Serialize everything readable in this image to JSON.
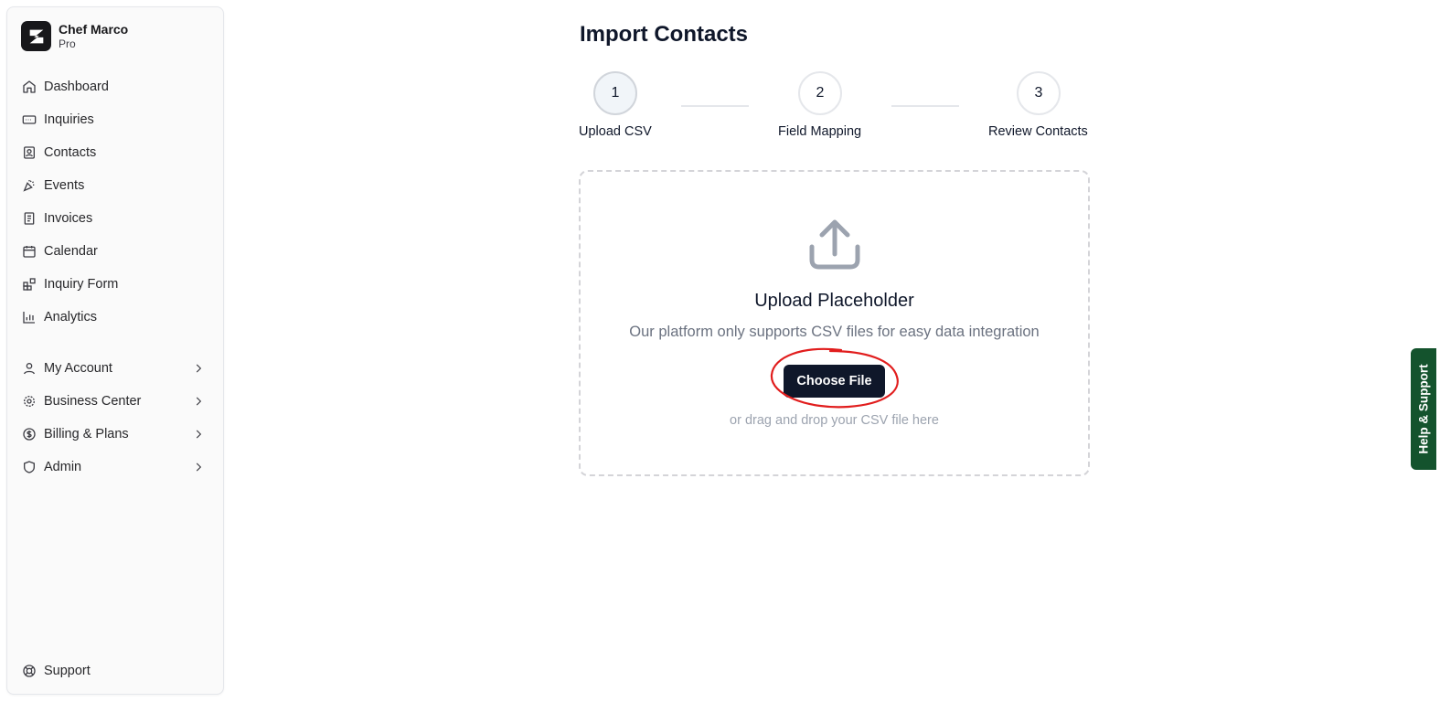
{
  "brand": {
    "name": "Chef Marco",
    "plan": "Pro"
  },
  "nav": {
    "primary": [
      {
        "label": "Dashboard",
        "icon": "home-icon"
      },
      {
        "label": "Inquiries",
        "icon": "inbox-icon"
      },
      {
        "label": "Contacts",
        "icon": "contact-card-icon"
      },
      {
        "label": "Events",
        "icon": "party-popper-icon"
      },
      {
        "label": "Invoices",
        "icon": "receipt-icon"
      },
      {
        "label": "Calendar",
        "icon": "calendar-icon"
      },
      {
        "label": "Inquiry Form",
        "icon": "form-blocks-icon"
      },
      {
        "label": "Analytics",
        "icon": "bar-chart-icon"
      }
    ],
    "secondary": [
      {
        "label": "My Account",
        "icon": "user-icon"
      },
      {
        "label": "Business Center",
        "icon": "gear-icon"
      },
      {
        "label": "Billing & Plans",
        "icon": "dollar-circle-icon"
      },
      {
        "label": "Admin",
        "icon": "shield-icon"
      }
    ],
    "support": {
      "label": "Support",
      "icon": "lifebuoy-icon"
    }
  },
  "page": {
    "title": "Import Contacts"
  },
  "steps": [
    {
      "number": "1",
      "label": "Upload CSV"
    },
    {
      "number": "2",
      "label": "Field Mapping"
    },
    {
      "number": "3",
      "label": "Review Contacts"
    }
  ],
  "upload": {
    "title": "Upload Placeholder",
    "description": "Our platform only supports CSV files for easy data integration",
    "button_label": "Choose File",
    "hint": "or drag and drop your CSV file here",
    "icon": "upload-icon"
  },
  "help_tab": {
    "label": "Help & Support"
  },
  "colors": {
    "primary_button": "#0f172a",
    "help_tab": "#14532d",
    "annotation": "#e11d1d"
  }
}
